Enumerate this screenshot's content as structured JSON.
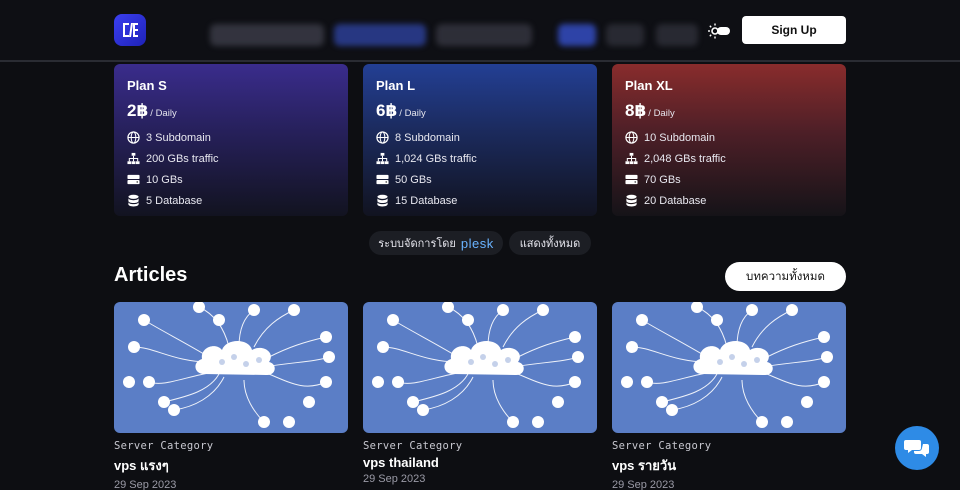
{
  "header": {
    "signup_label": "Sign Up"
  },
  "plans": [
    {
      "name": "Plan S",
      "price": "2฿",
      "unit": "/ Daily",
      "features": [
        "3 Subdomain",
        "200 GBs traffic",
        "10 GBs",
        "5 Database"
      ]
    },
    {
      "name": "Plan L",
      "price": "6฿",
      "unit": "/ Daily",
      "features": [
        "8 Subdomain",
        "1,024 GBs traffic",
        "50 GBs",
        "15 Database"
      ]
    },
    {
      "name": "Plan XL",
      "price": "8฿",
      "unit": "/ Daily",
      "features": [
        "10 Subdomain",
        "2,048 GBs traffic",
        "70 GBs",
        "20 Database"
      ]
    }
  ],
  "feature_icons": [
    "globe-icon",
    "network-icon",
    "server-icon",
    "database-icon"
  ],
  "pills": {
    "managed_by": "ระบบจัดการโดย",
    "plesk": "plesk",
    "show_all": "แสดงทั้งหมด"
  },
  "articles": {
    "title": "Articles",
    "all_label": "บทความทั้งหมด",
    "items": [
      {
        "category": "Server Category",
        "title": "vps แรงๆ",
        "date": "29 Sep 2023"
      },
      {
        "category": "Server Category",
        "title": "vps thailand",
        "date": "29 Sep 2023"
      },
      {
        "category": "Server Category",
        "title": "vps รายวัน",
        "date": "29 Sep 2023"
      }
    ]
  },
  "colors": {
    "plan_s": "#3a2c8c",
    "plan_l": "#233f94",
    "plan_xl": "#892c2c",
    "thumb_bg": "#5b7ec6",
    "chat": "#2e8be6"
  }
}
